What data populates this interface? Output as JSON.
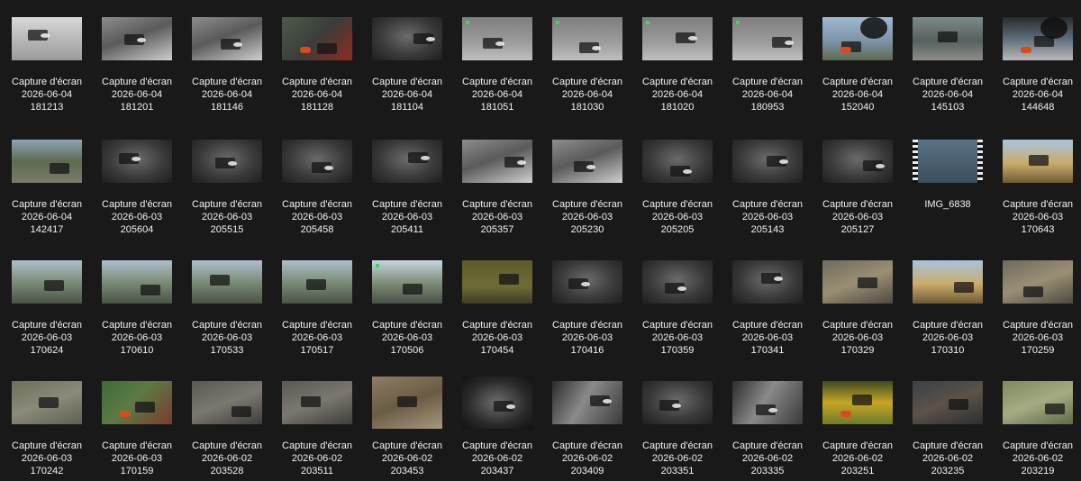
{
  "explorer": {
    "files": [
      {
        "line1": "Capture d'écran",
        "line2": "2026-06-04",
        "line3": "181213",
        "kind": "thermal-van"
      },
      {
        "line1": "Capture d'écran",
        "line2": "2026-06-04",
        "line3": "181201",
        "kind": "thermal"
      },
      {
        "line1": "Capture d'écran",
        "line2": "2026-06-04",
        "line3": "181146",
        "kind": "thermal"
      },
      {
        "line1": "Capture d'écran",
        "line2": "2026-06-04",
        "line3": "181128",
        "kind": "truck-red"
      },
      {
        "line1": "Capture d'écran",
        "line2": "2026-06-04",
        "line3": "181104",
        "kind": "thermal-dark"
      },
      {
        "line1": "Capture d'écran",
        "line2": "2026-06-04",
        "line3": "181051",
        "kind": "thermal-hud"
      },
      {
        "line1": "Capture d'écran",
        "line2": "2026-06-04",
        "line3": "181030",
        "kind": "thermal-hud"
      },
      {
        "line1": "Capture d'écran",
        "line2": "2026-06-04",
        "line3": "181020",
        "kind": "thermal-hud"
      },
      {
        "line1": "Capture d'écran",
        "line2": "2026-06-04",
        "line3": "180953",
        "kind": "thermal-hud"
      },
      {
        "line1": "Capture d'écran",
        "line2": "2026-06-04",
        "line3": "152040",
        "kind": "smoke-sky"
      },
      {
        "line1": "Capture d'écran",
        "line2": "2026-06-04",
        "line3": "145103",
        "kind": "road-grey"
      },
      {
        "line1": "Capture d'écran",
        "line2": "2026-06-04",
        "line3": "144648",
        "kind": "smoke-truck"
      },
      {
        "line1": "Capture d'écran",
        "line2": "2026-06-04",
        "line3": "142417",
        "kind": "trees-car"
      },
      {
        "line1": "Capture d'écran",
        "line2": "2026-06-03",
        "line3": "205604",
        "kind": "thermal-dark"
      },
      {
        "line1": "Capture d'écran",
        "line2": "2026-06-03",
        "line3": "205515",
        "kind": "thermal-dark"
      },
      {
        "line1": "Capture d'écran",
        "line2": "2026-06-03",
        "line3": "205458",
        "kind": "thermal-dark"
      },
      {
        "line1": "Capture d'écran",
        "line2": "2026-06-03",
        "line3": "205411",
        "kind": "thermal-dark"
      },
      {
        "line1": "Capture d'écran",
        "line2": "2026-06-03",
        "line3": "205357",
        "kind": "thermal"
      },
      {
        "line1": "Capture d'écran",
        "line2": "2026-06-03",
        "line3": "205230",
        "kind": "thermal"
      },
      {
        "line1": "Capture d'écran",
        "line2": "2026-06-03",
        "line3": "205205",
        "kind": "thermal-dark"
      },
      {
        "line1": "Capture d'écran",
        "line2": "2026-06-03",
        "line3": "205143",
        "kind": "thermal-dark"
      },
      {
        "line1": "Capture d'écran",
        "line2": "2026-06-03",
        "line3": "205127",
        "kind": "thermal-dark"
      },
      {
        "line1": "IMG_6838",
        "line2": "",
        "line3": "",
        "kind": "video"
      },
      {
        "line1": "Capture d'écran",
        "line2": "2026-06-03",
        "line3": "170643",
        "kind": "field-sunset"
      },
      {
        "line1": "Capture d'écran",
        "line2": "2026-06-03",
        "line3": "170624",
        "kind": "road-day"
      },
      {
        "line1": "Capture d'écran",
        "line2": "2026-06-03",
        "line3": "170610",
        "kind": "road-day"
      },
      {
        "line1": "Capture d'écran",
        "line2": "2026-06-03",
        "line3": "170533",
        "kind": "road-day"
      },
      {
        "line1": "Capture d'écran",
        "line2": "2026-06-03",
        "line3": "170517",
        "kind": "road-day"
      },
      {
        "line1": "Capture d'écran",
        "line2": "2026-06-03",
        "line3": "170506",
        "kind": "road-hud"
      },
      {
        "line1": "Capture d'écran",
        "line2": "2026-06-03",
        "line3": "170454",
        "kind": "field-olive"
      },
      {
        "line1": "Capture d'écran",
        "line2": "2026-06-03",
        "line3": "170416",
        "kind": "thermal-dark"
      },
      {
        "line1": "Capture d'écran",
        "line2": "2026-06-03",
        "line3": "170359",
        "kind": "thermal-dark"
      },
      {
        "line1": "Capture d'écran",
        "line2": "2026-06-03",
        "line3": "170341",
        "kind": "thermal-dark"
      },
      {
        "line1": "Capture d'écran",
        "line2": "2026-06-03",
        "line3": "170329",
        "kind": "blur-road"
      },
      {
        "line1": "Capture d'écran",
        "line2": "2026-06-03",
        "line3": "170310",
        "kind": "field-sunset"
      },
      {
        "line1": "Capture d'écran",
        "line2": "2026-06-03",
        "line3": "170259",
        "kind": "blur-road"
      },
      {
        "line1": "Capture d'écran",
        "line2": "2026-06-03",
        "line3": "170242",
        "kind": "dirt-road"
      },
      {
        "line1": "Capture d'écran",
        "line2": "2026-06-03",
        "line3": "170159",
        "kind": "fire-vehicle"
      },
      {
        "line1": "Capture d'écran",
        "line2": "2026-06-02",
        "line3": "203528",
        "kind": "rubble"
      },
      {
        "line1": "Capture d'écran",
        "line2": "2026-06-02",
        "line3": "203511",
        "kind": "rubble"
      },
      {
        "line1": "Capture d'écran",
        "line2": "2026-06-02",
        "line3": "203453",
        "kind": "rubble-brown"
      },
      {
        "line1": "Capture d'écran",
        "line2": "2026-06-02",
        "line3": "203437",
        "kind": "thermal-tall"
      },
      {
        "line1": "Capture d'écran",
        "line2": "2026-06-02",
        "line3": "203409",
        "kind": "thermal-road"
      },
      {
        "line1": "Capture d'écran",
        "line2": "2026-06-02",
        "line3": "203351",
        "kind": "thermal-dark"
      },
      {
        "line1": "Capture d'écran",
        "line2": "2026-06-02",
        "line3": "203335",
        "kind": "thermal-road"
      },
      {
        "line1": "Capture d'écran",
        "line2": "2026-06-02",
        "line3": "203251",
        "kind": "field-yellow"
      },
      {
        "line1": "Capture d'écran",
        "line2": "2026-06-02",
        "line3": "203235",
        "kind": "blur-dark"
      },
      {
        "line1": "Capture d'écran",
        "line2": "2026-06-02",
        "line3": "203219",
        "kind": "blur-green"
      }
    ]
  }
}
